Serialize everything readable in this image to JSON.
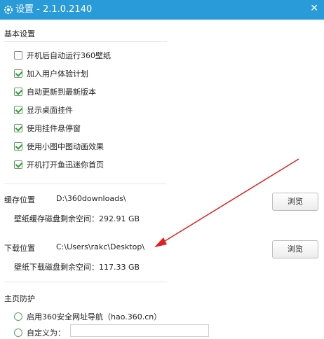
{
  "window": {
    "title": "设置 - 2.1.0.2140"
  },
  "basic": {
    "heading": "基本设置",
    "options": [
      {
        "label": "开机后自动运行360壁纸",
        "checked": false
      },
      {
        "label": "加入用户体验计划",
        "checked": true
      },
      {
        "label": "自动更新到最新版本",
        "checked": true
      },
      {
        "label": "显示桌面挂件",
        "checked": true
      },
      {
        "label": "使用挂件悬停窗",
        "checked": true
      },
      {
        "label": "使用小图中图动画效果",
        "checked": true
      },
      {
        "label": "开机打开鱼迅迷你首页",
        "checked": true
      }
    ]
  },
  "cache": {
    "label": "缓存位置",
    "path": "D:\\360downloads\\",
    "free_text": "壁纸缓存磁盘剩余空间：292.91 GB",
    "browse": "浏览"
  },
  "download": {
    "label": "下载位置",
    "path": "C:\\Users\\rakc\\Desktop\\",
    "free_text": "壁纸下载磁盘剩余空间：117.33 GB",
    "browse": "浏览"
  },
  "homepage": {
    "heading": "主页防护",
    "radio1": "启用360安全网址导航（hao.360.cn）",
    "radio2": "自定义为：",
    "custom_value": ""
  },
  "colors": {
    "titlebar": "#2a9bd9",
    "arrow": "#e02020"
  }
}
